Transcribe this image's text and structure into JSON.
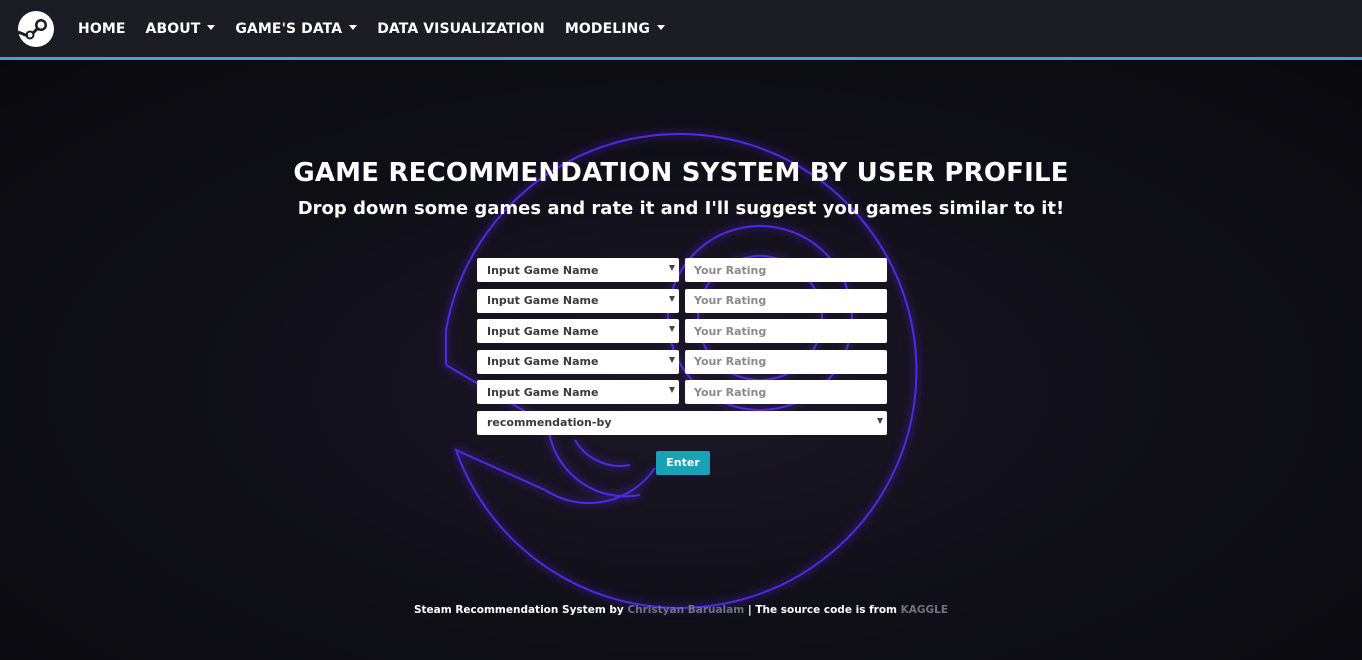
{
  "nav": {
    "logo_icon": "steam-logo-icon",
    "items": [
      {
        "label": "HOME",
        "dropdown": false
      },
      {
        "label": "ABOUT",
        "dropdown": true
      },
      {
        "label": "GAME'S DATA",
        "dropdown": true
      },
      {
        "label": "DATA VISUALIZATION",
        "dropdown": false
      },
      {
        "label": "MODELING",
        "dropdown": true
      }
    ]
  },
  "hero": {
    "title": "GAME RECOMMENDATION SYSTEM BY USER PROFILE",
    "subtitle": "Drop down some games and rate it and I'll suggest you games similar to it!"
  },
  "form": {
    "game_select_value": "Input Game Name",
    "rating_placeholder": "Your Rating",
    "rows": 5,
    "recommendation_select_value": "recommendation-by",
    "submit_label": "Enter"
  },
  "footer": {
    "prefix": "Steam Recommendation System by",
    "author": "Christyan Barualam",
    "separator": "| The source code is from",
    "source": "KAGGLE"
  },
  "colors": {
    "nav_bg": "#1c1d24",
    "nav_border": "#3aa6df",
    "glow": "#5a2cff",
    "button": "#17a2b8"
  }
}
